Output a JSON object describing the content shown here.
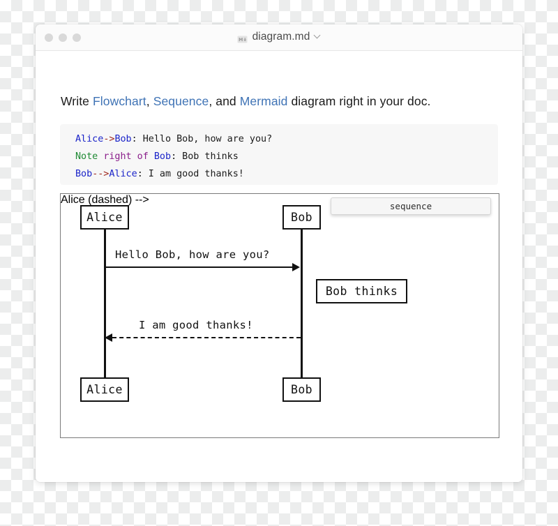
{
  "window": {
    "title": "diagram.md",
    "title_icon": "markdown-icon",
    "dropdown_icon": "chevron-down-icon",
    "traffic_lights": [
      "close-button",
      "minimize-button",
      "maximize-button"
    ]
  },
  "doc": {
    "intro": {
      "part1": "Write ",
      "link1": "Flowchart",
      "part2": ", ",
      "link2": "Sequence",
      "part3": ", and ",
      "link3": "Mermaid",
      "part4": " diagram right in your doc."
    },
    "code": {
      "lines": [
        {
          "tokens": [
            {
              "t": "Alice",
              "c": "actor"
            },
            {
              "t": "->",
              "c": "arrow"
            },
            {
              "t": "Bob",
              "c": "actor"
            },
            {
              "t": ": Hello Bob, how are you?",
              "c": "plain"
            }
          ]
        },
        {
          "tokens": [
            {
              "t": "Note",
              "c": "kw"
            },
            {
              "t": " ",
              "c": "plain"
            },
            {
              "t": "right of",
              "c": "mod"
            },
            {
              "t": " ",
              "c": "plain"
            },
            {
              "t": "Bob",
              "c": "actor"
            },
            {
              "t": ": Bob thinks",
              "c": "plain"
            }
          ]
        },
        {
          "tokens": [
            {
              "t": "Bob",
              "c": "actor"
            },
            {
              "t": "-->",
              "c": "arrow"
            },
            {
              "t": "Alice",
              "c": "actor"
            },
            {
              "t": ": I am good thanks!",
              "c": "plain"
            }
          ]
        }
      ]
    }
  },
  "diagram": {
    "tab_label": "sequence",
    "actors": [
      {
        "name": "Alice",
        "position": "top-left"
      },
      {
        "name": "Bob",
        "position": "top-right"
      },
      {
        "name": "Alice",
        "position": "bottom-left"
      },
      {
        "name": "Bob",
        "position": "bottom-right"
      }
    ],
    "messages": [
      {
        "text": "Hello Bob, how are you?",
        "direction": "right",
        "style": "solid"
      },
      {
        "text": "I am good thanks!",
        "direction": "left",
        "style": "dashed"
      }
    ],
    "notes": [
      {
        "text": "Bob thinks",
        "placement": "right of Bob"
      }
    ]
  },
  "colors": {
    "link": "#3f73b5",
    "code_actor": "#1b24c9",
    "code_arrow": "#a0291f",
    "code_keyword": "#1f8a34",
    "code_modifier": "#8b1f8b",
    "diagram_stroke": "#111111"
  }
}
